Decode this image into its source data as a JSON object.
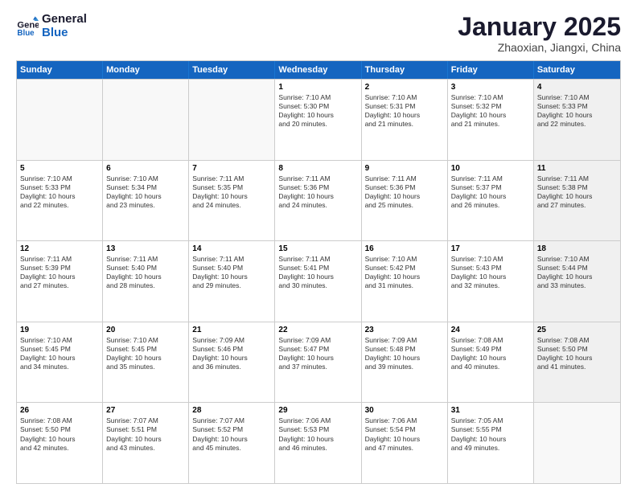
{
  "header": {
    "logo_line1": "General",
    "logo_line2": "Blue",
    "month_title": "January 2025",
    "location": "Zhaoxian, Jiangxi, China"
  },
  "weekdays": [
    "Sunday",
    "Monday",
    "Tuesday",
    "Wednesday",
    "Thursday",
    "Friday",
    "Saturday"
  ],
  "rows": [
    [
      {
        "day": "",
        "info": "",
        "empty": true
      },
      {
        "day": "",
        "info": "",
        "empty": true
      },
      {
        "day": "",
        "info": "",
        "empty": true
      },
      {
        "day": "1",
        "info": "Sunrise: 7:10 AM\nSunset: 5:30 PM\nDaylight: 10 hours\nand 20 minutes.",
        "empty": false
      },
      {
        "day": "2",
        "info": "Sunrise: 7:10 AM\nSunset: 5:31 PM\nDaylight: 10 hours\nand 21 minutes.",
        "empty": false
      },
      {
        "day": "3",
        "info": "Sunrise: 7:10 AM\nSunset: 5:32 PM\nDaylight: 10 hours\nand 21 minutes.",
        "empty": false
      },
      {
        "day": "4",
        "info": "Sunrise: 7:10 AM\nSunset: 5:33 PM\nDaylight: 10 hours\nand 22 minutes.",
        "empty": false,
        "shaded": true
      }
    ],
    [
      {
        "day": "5",
        "info": "Sunrise: 7:10 AM\nSunset: 5:33 PM\nDaylight: 10 hours\nand 22 minutes.",
        "empty": false
      },
      {
        "day": "6",
        "info": "Sunrise: 7:10 AM\nSunset: 5:34 PM\nDaylight: 10 hours\nand 23 minutes.",
        "empty": false
      },
      {
        "day": "7",
        "info": "Sunrise: 7:11 AM\nSunset: 5:35 PM\nDaylight: 10 hours\nand 24 minutes.",
        "empty": false
      },
      {
        "day": "8",
        "info": "Sunrise: 7:11 AM\nSunset: 5:36 PM\nDaylight: 10 hours\nand 24 minutes.",
        "empty": false
      },
      {
        "day": "9",
        "info": "Sunrise: 7:11 AM\nSunset: 5:36 PM\nDaylight: 10 hours\nand 25 minutes.",
        "empty": false
      },
      {
        "day": "10",
        "info": "Sunrise: 7:11 AM\nSunset: 5:37 PM\nDaylight: 10 hours\nand 26 minutes.",
        "empty": false
      },
      {
        "day": "11",
        "info": "Sunrise: 7:11 AM\nSunset: 5:38 PM\nDaylight: 10 hours\nand 27 minutes.",
        "empty": false,
        "shaded": true
      }
    ],
    [
      {
        "day": "12",
        "info": "Sunrise: 7:11 AM\nSunset: 5:39 PM\nDaylight: 10 hours\nand 27 minutes.",
        "empty": false
      },
      {
        "day": "13",
        "info": "Sunrise: 7:11 AM\nSunset: 5:40 PM\nDaylight: 10 hours\nand 28 minutes.",
        "empty": false
      },
      {
        "day": "14",
        "info": "Sunrise: 7:11 AM\nSunset: 5:40 PM\nDaylight: 10 hours\nand 29 minutes.",
        "empty": false
      },
      {
        "day": "15",
        "info": "Sunrise: 7:11 AM\nSunset: 5:41 PM\nDaylight: 10 hours\nand 30 minutes.",
        "empty": false
      },
      {
        "day": "16",
        "info": "Sunrise: 7:10 AM\nSunset: 5:42 PM\nDaylight: 10 hours\nand 31 minutes.",
        "empty": false
      },
      {
        "day": "17",
        "info": "Sunrise: 7:10 AM\nSunset: 5:43 PM\nDaylight: 10 hours\nand 32 minutes.",
        "empty": false
      },
      {
        "day": "18",
        "info": "Sunrise: 7:10 AM\nSunset: 5:44 PM\nDaylight: 10 hours\nand 33 minutes.",
        "empty": false,
        "shaded": true
      }
    ],
    [
      {
        "day": "19",
        "info": "Sunrise: 7:10 AM\nSunset: 5:45 PM\nDaylight: 10 hours\nand 34 minutes.",
        "empty": false
      },
      {
        "day": "20",
        "info": "Sunrise: 7:10 AM\nSunset: 5:45 PM\nDaylight: 10 hours\nand 35 minutes.",
        "empty": false
      },
      {
        "day": "21",
        "info": "Sunrise: 7:09 AM\nSunset: 5:46 PM\nDaylight: 10 hours\nand 36 minutes.",
        "empty": false
      },
      {
        "day": "22",
        "info": "Sunrise: 7:09 AM\nSunset: 5:47 PM\nDaylight: 10 hours\nand 37 minutes.",
        "empty": false
      },
      {
        "day": "23",
        "info": "Sunrise: 7:09 AM\nSunset: 5:48 PM\nDaylight: 10 hours\nand 39 minutes.",
        "empty": false
      },
      {
        "day": "24",
        "info": "Sunrise: 7:08 AM\nSunset: 5:49 PM\nDaylight: 10 hours\nand 40 minutes.",
        "empty": false
      },
      {
        "day": "25",
        "info": "Sunrise: 7:08 AM\nSunset: 5:50 PM\nDaylight: 10 hours\nand 41 minutes.",
        "empty": false,
        "shaded": true
      }
    ],
    [
      {
        "day": "26",
        "info": "Sunrise: 7:08 AM\nSunset: 5:50 PM\nDaylight: 10 hours\nand 42 minutes.",
        "empty": false
      },
      {
        "day": "27",
        "info": "Sunrise: 7:07 AM\nSunset: 5:51 PM\nDaylight: 10 hours\nand 43 minutes.",
        "empty": false
      },
      {
        "day": "28",
        "info": "Sunrise: 7:07 AM\nSunset: 5:52 PM\nDaylight: 10 hours\nand 45 minutes.",
        "empty": false
      },
      {
        "day": "29",
        "info": "Sunrise: 7:06 AM\nSunset: 5:53 PM\nDaylight: 10 hours\nand 46 minutes.",
        "empty": false
      },
      {
        "day": "30",
        "info": "Sunrise: 7:06 AM\nSunset: 5:54 PM\nDaylight: 10 hours\nand 47 minutes.",
        "empty": false
      },
      {
        "day": "31",
        "info": "Sunrise: 7:05 AM\nSunset: 5:55 PM\nDaylight: 10 hours\nand 49 minutes.",
        "empty": false
      },
      {
        "day": "",
        "info": "",
        "empty": true,
        "shaded": true
      }
    ]
  ]
}
